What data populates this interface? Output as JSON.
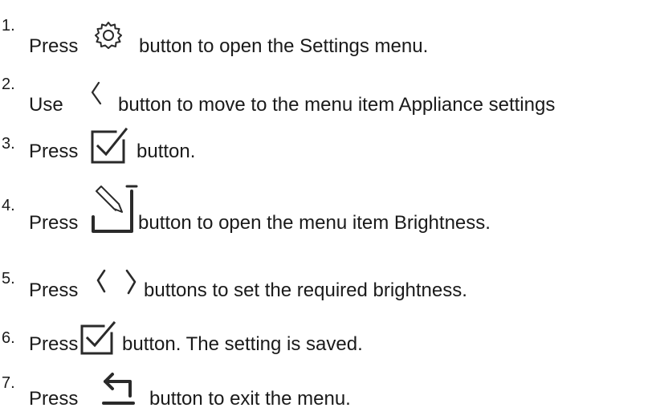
{
  "steps": [
    {
      "number": "1.",
      "before": "Press",
      "icon": "gear-icon",
      "after": "button to open the Settings menu."
    },
    {
      "number": "2.",
      "before": "Use",
      "icon": "chevron-left-icon",
      "after": "button to move to the menu item Appliance settings"
    },
    {
      "number": "3.",
      "before": "Press",
      "icon": "checkbox-check-icon",
      "after": "button."
    },
    {
      "number": "4.",
      "before": "Press",
      "icon": "edit-box-icon",
      "after": "button to open the menu item Brightness."
    },
    {
      "number": "5.",
      "before": "Press",
      "icon": "chevron-left-right-icon",
      "after": "buttons to set the required brightness."
    },
    {
      "number": "6.",
      "before": "Press",
      "icon": "checkbox-check-icon",
      "after": "button. The setting is saved."
    },
    {
      "number": "7.",
      "before": "Press",
      "icon": "back-arrow-icon",
      "after": "button to exit the menu."
    }
  ],
  "colors": {
    "text": "#1a1a1a",
    "icon_stroke": "#2a2a2a"
  }
}
